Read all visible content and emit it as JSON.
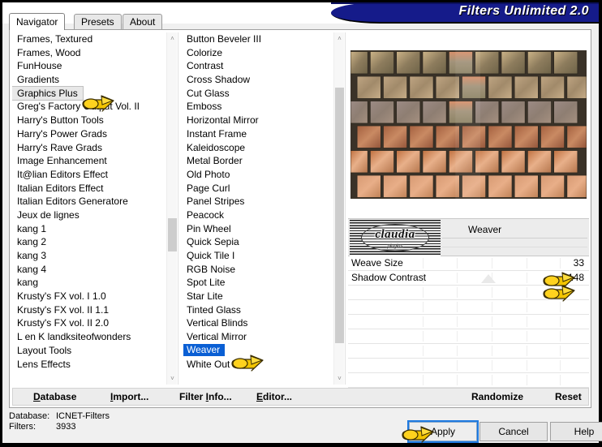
{
  "window": {
    "title": "Filters Unlimited 2.0",
    "accent_navy": "#151b8a",
    "selection_blue": "#0a5fd4",
    "focus_blue": "#1f7ae0",
    "hand_yellow": "#ffd21e"
  },
  "tabs": [
    {
      "label": "Navigator",
      "active": true
    },
    {
      "label": "Presets",
      "active": false
    },
    {
      "label": "About",
      "active": false
    }
  ],
  "category_list": {
    "items": [
      "Frames, Textured",
      "Frames, Wood",
      "FunHouse",
      "Gradients",
      "Graphics Plus",
      "Greg's Factory Output Vol. II",
      "Harry's Button Tools",
      "Harry's Power Grads",
      "Harry's Rave Grads",
      "Image Enhancement",
      "It@lian Editors Effect",
      "Italian Editors Effect",
      "Italian Editors Generatore",
      "Jeux de lignes",
      "kang 1",
      "kang 2",
      "kang 3",
      "kang 4",
      "kang",
      "Krusty's FX vol. I 1.0",
      "Krusty's FX vol. II 1.1",
      "Krusty's FX vol. II 2.0",
      "L en K landksiteofwonders",
      "Layout Tools",
      "Lens Effects"
    ],
    "selected": "Graphics Plus",
    "selected_index": 4,
    "scroll_thumb_top_pct": 53,
    "scroll_thumb_height_pct": 10
  },
  "effect_list": {
    "items": [
      "Button Beveler III",
      "Colorize",
      "Contrast",
      "Cross Shadow",
      "Cut Glass",
      "Emboss",
      "Horizontal Mirror",
      "Instant Frame",
      "Kaleidoscope",
      "Metal Border",
      "Old Photo",
      "Page Curl",
      "Panel Stripes",
      "Peacock",
      "Pin Wheel",
      "Quick Sepia",
      "Quick Tile I",
      "RGB Noise",
      "Spot Lite",
      "Star Lite",
      "Tinted Glass",
      "Vertical Blinds",
      "Vertical Mirror",
      "Weaver",
      "White Out"
    ],
    "selected": "Weaver",
    "selected_index": 23,
    "scroll_thumb_top_pct": 13,
    "scroll_thumb_height_pct": 78
  },
  "preview": {
    "effect_name": "Weaver",
    "logo_text": "claudia",
    "logo_subtext": "plugins"
  },
  "parameters": [
    {
      "label": "Weave Size",
      "value": "33"
    },
    {
      "label": "Shadow Contrast",
      "value": "148"
    }
  ],
  "links": [
    {
      "label": "Database",
      "accel": "D"
    },
    {
      "label": "Import...",
      "accel": "I"
    },
    {
      "label": "Filter Info...",
      "accel": "I"
    },
    {
      "label": "Editor...",
      "accel": "E"
    },
    {
      "label": "Randomize",
      "accel": ""
    },
    {
      "label": "Reset",
      "accel": ""
    }
  ],
  "status": {
    "database_key": "Database:",
    "database_value": "ICNET-Filters",
    "filters_key": "Filters:",
    "filters_value": "3933"
  },
  "buttons": {
    "apply": "Apply",
    "cancel": "Cancel",
    "help": "Help"
  },
  "icons": {
    "scroll_up": "˄",
    "scroll_down": "˅"
  }
}
